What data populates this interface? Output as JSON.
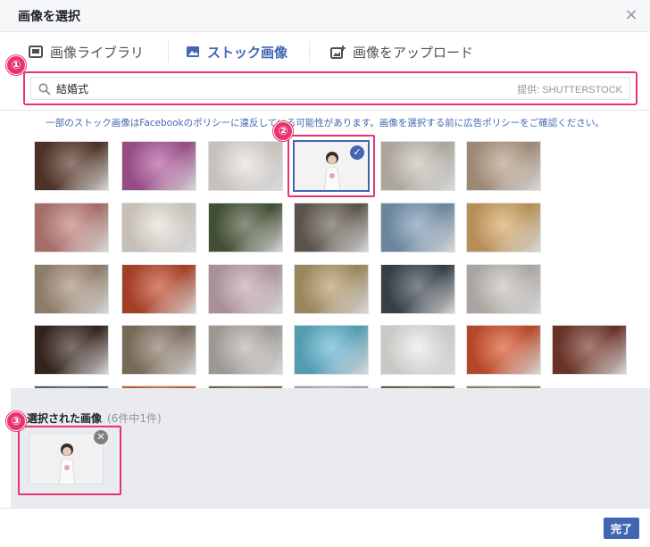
{
  "dialog": {
    "title": "画像を選択",
    "close_glyph": "×"
  },
  "tabs": [
    {
      "label": "画像ライブラリ",
      "icon": "image-library-icon",
      "active": false
    },
    {
      "label": "ストック画像",
      "icon": "stock-image-icon",
      "active": true
    },
    {
      "label": "画像をアップロード",
      "icon": "image-upload-icon",
      "active": false
    }
  ],
  "search": {
    "value": "結婚式",
    "provider": "提供: SHUTTERSTOCK"
  },
  "notice": "一部のストック画像はFacebookのポリシーに違反している可能性があります。画像を選択する前に広告ポリシーをご確認ください。",
  "annotations": [
    "①",
    "②",
    "③"
  ],
  "grid": {
    "rows": [
      [
        "#5a3a2c",
        "#b05a9c",
        "#e8e3dc",
        "#f4f1ee",
        "#c9c2b8",
        "#b9a08a"
      ],
      [
        "#c1807a",
        "#e8e0d8",
        "#4d5b3e",
        "#6a6258",
        "#7e9cb7",
        "#d6a866"
      ],
      [
        "#a7917c",
        "#c04a2e",
        "#c7a9b1",
        "#b59c6d",
        "#3f4a52",
        "#c8c2bc"
      ],
      [
        "#3b2922",
        "#8c7a68",
        "#b9b3ad",
        "#62b7d1",
        "#ecebe8",
        "#d7552e",
        "#7a3b2e"
      ],
      [
        "#5b6e88",
        "#d96b35",
        "#84725f",
        "#bebcba",
        "#6d6a52",
        "#8f9a76"
      ]
    ],
    "selected_index": [
      0,
      3
    ],
    "selected_check": "✓"
  },
  "selected": {
    "label": "選択された画像",
    "count": "(6件中1件)",
    "remove_glyph": "✕"
  },
  "footer": {
    "done_label": "完了"
  },
  "colors": {
    "accent": "#4267b2",
    "highlight": "#e8336f",
    "panel": "#e9ebee"
  }
}
